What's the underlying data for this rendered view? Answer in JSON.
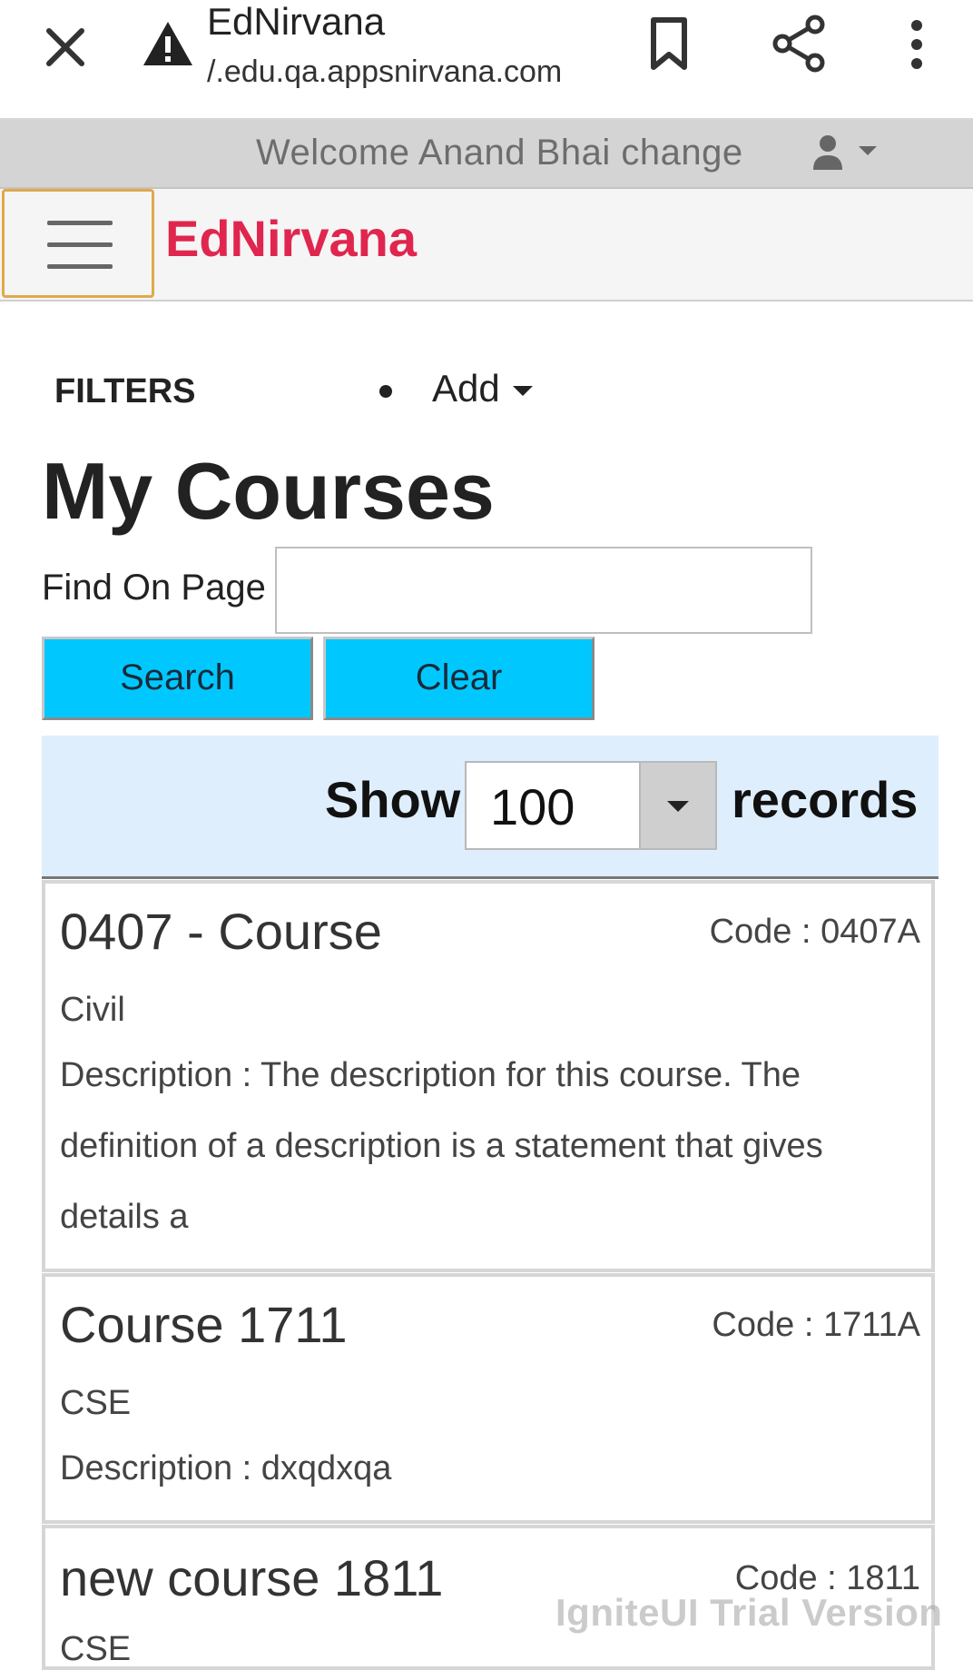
{
  "browser": {
    "title": "EdNirvana",
    "url": "/.edu.qa.appsnirvana.com",
    "icons": [
      "close-icon",
      "warning-icon",
      "bookmark-icon",
      "share-icon",
      "more-vert-icon"
    ]
  },
  "welcome_bar": {
    "text": "Welcome Anand Bhai change",
    "user_icon": "user-icon"
  },
  "navbar": {
    "brand": "EdNirvana",
    "menu_icon": "hamburger-icon"
  },
  "filters": {
    "label": "FILTERS",
    "add_label": "Add"
  },
  "page": {
    "title": "My Courses"
  },
  "search": {
    "label": "Find On Page",
    "value": "",
    "placeholder": "",
    "search_button": "Search",
    "clear_button": "Clear"
  },
  "records": {
    "show_label": "Show",
    "selected": "100",
    "records_label": "records"
  },
  "courses": [
    {
      "name": "0407 - Course",
      "code": "Code : 0407A",
      "department": "Civil",
      "description": "Description : The description for this course. The definition of a description is a statement that gives details a"
    },
    {
      "name": "Course 1711",
      "code": "Code : 1711A",
      "department": "CSE",
      "description": "Description : dxqdxqa"
    },
    {
      "name": "new course 1811",
      "code": "Code : 1811",
      "department": "CSE",
      "description": ""
    }
  ],
  "watermark": "IgniteUI Trial Version",
  "colors": {
    "brand": "#e0264e",
    "button": "#00c8ff",
    "show_bar": "#deeefc",
    "welcome_bar": "#d4d4d4"
  }
}
